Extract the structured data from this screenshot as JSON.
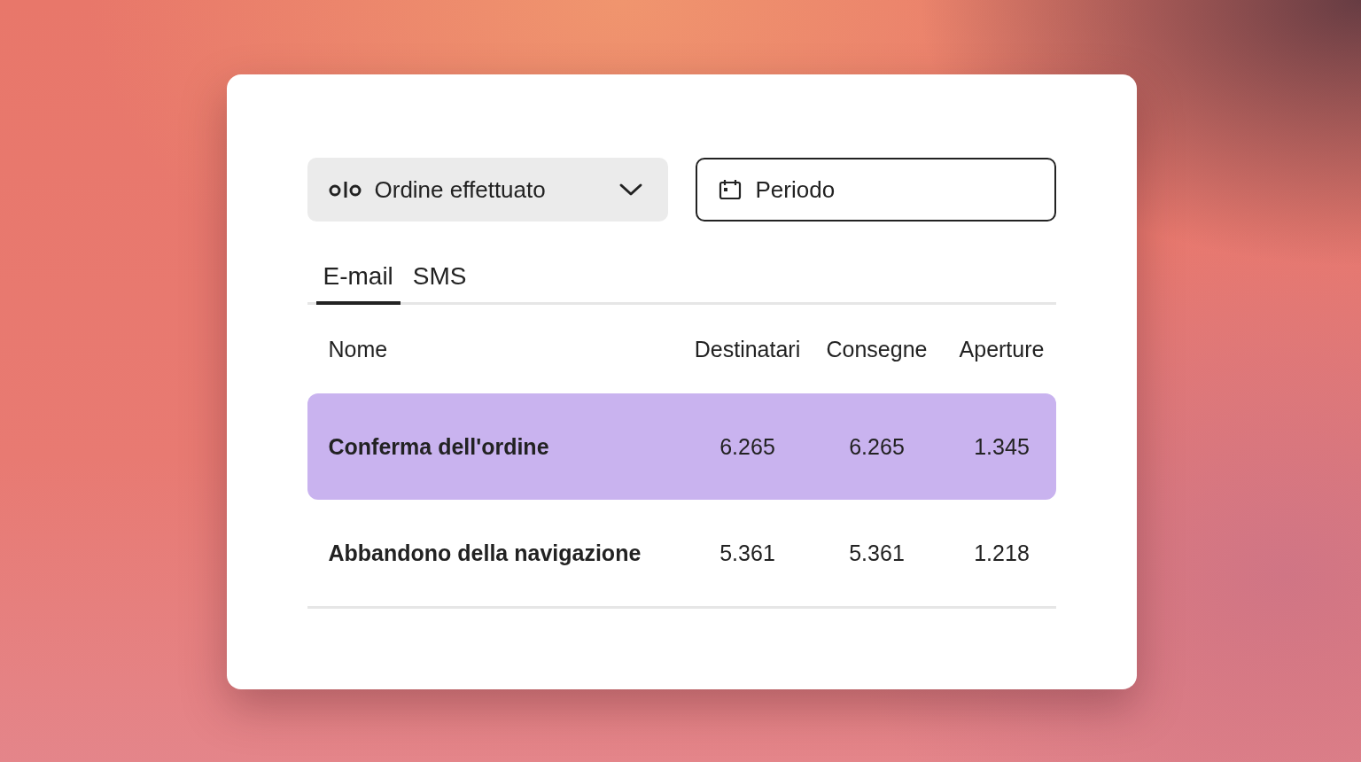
{
  "filters": {
    "event": {
      "label": "Ordine effettuato"
    },
    "period": {
      "label": "Periodo"
    }
  },
  "tabs": [
    {
      "label": "E-mail",
      "selected": true
    },
    {
      "label": "SMS",
      "selected": false
    }
  ],
  "table": {
    "columns": [
      "Nome",
      "Destinatari",
      "Consegne",
      "Aperture"
    ],
    "rows": [
      {
        "name": "Conferma dell'ordine",
        "values": [
          "6.265",
          "6.265",
          "1.345"
        ],
        "selected": true
      },
      {
        "name": "Abbandono della navigazione",
        "values": [
          "5.361",
          "5.361",
          "1.218"
        ],
        "selected": false
      }
    ]
  }
}
